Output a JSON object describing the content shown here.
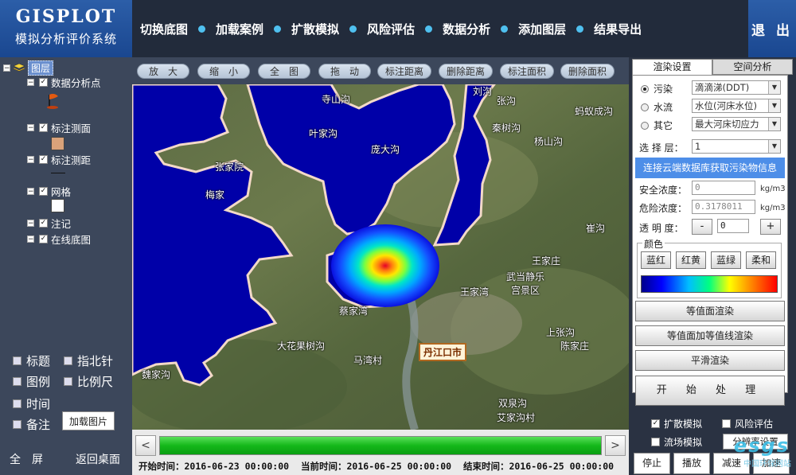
{
  "header": {
    "logo_title": "GISPLOT",
    "logo_subtitle": "模拟分析评价系统",
    "nav": [
      "切换底图",
      "加载案例",
      "扩散模拟",
      "风险评估",
      "数据分析",
      "添加图层",
      "结果导出"
    ],
    "exit_label": "退 出"
  },
  "layer_tree": {
    "root_label": "图层",
    "layers": [
      {
        "label": "数据分析点",
        "checked": true
      },
      {
        "label": "标注测面",
        "checked": true
      },
      {
        "label": "标注测距",
        "checked": true
      },
      {
        "label": "网格",
        "checked": true
      },
      {
        "label": "注记",
        "checked": true
      },
      {
        "label": "在线底图",
        "checked": true
      }
    ]
  },
  "map_options": {
    "title": "标题",
    "north_arrow": "指北针",
    "legend": "图例",
    "scale_bar": "比例尺",
    "time": "时间",
    "note": "备注",
    "load_image": "加载图片"
  },
  "left_footer": {
    "full_screen": "全　屏",
    "back_desktop": "返回桌面"
  },
  "toolbar": [
    "放　大",
    "缩　小",
    "全　图",
    "拖　动",
    "标注距离",
    "删除距离",
    "标注面积",
    "删除面积"
  ],
  "map": {
    "places": [
      "寺山沟",
      "刘沟",
      "张沟",
      "蚂蚁成沟",
      "叶家沟",
      "秦树沟",
      "杨山沟",
      "庞大沟",
      "张家院",
      "梅家",
      "崔沟",
      "王家庄",
      "武当静乐",
      "宫景区",
      "王家湾",
      "蔡家湾",
      "大花果树沟",
      "马湾村",
      "上张沟",
      "陈家庄",
      "魏家沟",
      "双泉沟",
      "艾家沟村"
    ],
    "city_label": "丹江口市"
  },
  "timeline": {
    "start_label": "开始时间：",
    "start_time": "2016-06-23 00:00:00",
    "current_label": "当前时间：",
    "current_time": "2016-06-25 00:00:00",
    "end_label": "结束时间：",
    "end_time": "2016-06-25 00:00:00",
    "progress": 1.0,
    "prev": "<",
    "next": ">"
  },
  "right_panel": {
    "tabs": [
      "渲染设置",
      "空间分析"
    ],
    "active_tab": 0,
    "radios": [
      {
        "label": "污染",
        "value": "滴滴涕(DDT)",
        "selected": true
      },
      {
        "label": "水流",
        "value": "水位(河床水位)",
        "selected": false
      },
      {
        "label": "其它",
        "value": "最大河床切应力",
        "selected": false
      }
    ],
    "layer_label": "选 择 层：",
    "layer_value": "1",
    "cloud_button": "连接云端数据库获取污染物信息",
    "safe_label": "安全浓度：",
    "safe_value": "0",
    "danger_label": "危险浓度：",
    "danger_value": "0.3178011",
    "unit": "kg/m3",
    "opacity_label": "透 明 度：",
    "opacity_minus": "-",
    "opacity_value": "0",
    "opacity_plus": "+",
    "color_legend": "颜色",
    "color_buttons": [
      "蓝红",
      "红黄",
      "蓝绿",
      "柔和"
    ],
    "render_buttons": [
      "等值面渲染",
      "等值面加等值线渲染",
      "平滑渲染"
    ],
    "start_button": "开 始 处 理"
  },
  "bottom_right": {
    "diffusion": "扩散模拟",
    "risk": "风险评估",
    "flow": "流场模拟",
    "scheme": "分辨率设置",
    "stop": "停止",
    "play": "播放",
    "pause": "减速",
    "speedup": "加速"
  },
  "watermark": {
    "logo": "esgs",
    "text": "中国环保网站"
  },
  "colors": {
    "water": "#0000a8",
    "accent": "#4d8ee8",
    "header": "#222b3b",
    "panel": "#3c475b"
  }
}
